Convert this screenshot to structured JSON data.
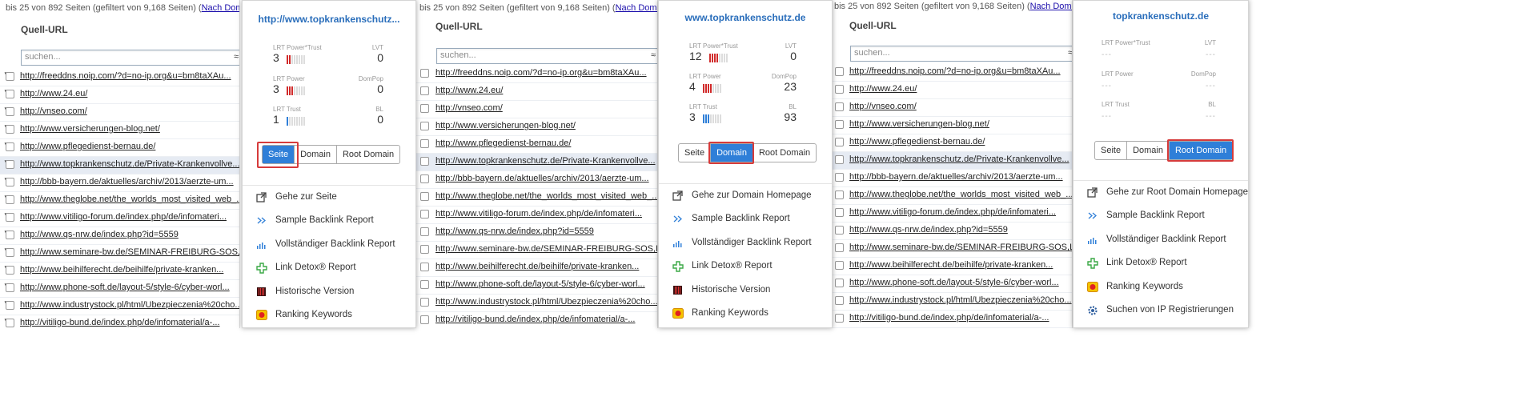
{
  "panel1": {
    "topinfo": "bis 25 von 892 Seiten (gefiltert von 9,168 Seiten) (",
    "toplink": "Nach Domain gr",
    "column": "Quell-URL",
    "search_placeholder": "suchen...",
    "search_symbol": "≈",
    "rows": [
      "http://freeddns.noip.com/?d=no-ip.org&u=bm8taXAu...",
      "http://www.24.eu/",
      "http://vnseo.com/",
      "http://www.versicherungen-blog.net/",
      "http://www.pflegedienst-bernau.de/",
      "http://www.topkrankenschutz.de/Private-Krankenvollve...",
      "http://bbb-bayern.de/aktuelles/archiv/2013/aerzte-um...",
      "http://www.theglobe.net/the_worlds_most_visited_web_...",
      "http://www.vitiligo-forum.de/index.php/de/infomateri...",
      "http://www.qs-nrw.de/index.php?id=5559",
      "http://www.seminare-bw.de/SEMINAR-FREIBURG-SOS,Lde/S...",
      "http://www.beihilferecht.de/beihilfe/private-kranken...",
      "http://www.phone-soft.de/layout-5/style-6/cyber-worl...",
      "http://www.industrystock.pl/html/Ubezpieczenia%20cho...",
      "http://vitiligo-bund.de/index.php/de/infomaterial/a-..."
    ]
  },
  "panel2": {
    "topinfo": "bis 25 von 892 Seiten (gefiltert von 9,168 Seiten) (",
    "toplink": "Nach Domain gr",
    "column": "Quell-URL",
    "search_placeholder": "suchen...",
    "search_symbol": "≈",
    "rows": [
      "http://freeddns.noip.com/?d=no-ip.org&u=bm8taXAu...",
      "http://www.24.eu/",
      "http://vnseo.com/",
      "http://www.versicherungen-blog.net/",
      "http://www.pflegedienst-bernau.de/",
      "http://www.topkrankenschutz.de/Private-Krankenvollve...",
      "http://bbb-bayern.de/aktuelles/archiv/2013/aerzte-um...",
      "http://www.theglobe.net/the_worlds_most_visited_web_...",
      "http://www.vitiligo-forum.de/index.php/de/infomateri...",
      "http://www.qs-nrw.de/index.php?id=5559",
      "http://www.seminare-bw.de/SEMINAR-FREIBURG-SOS,Lde/S...",
      "http://www.beihilferecht.de/beihilfe/private-kranken...",
      "http://www.phone-soft.de/layout-5/style-6/cyber-worl...",
      "http://www.industrystock.pl/html/Ubezpieczenia%20cho...",
      "http://vitiligo-bund.de/index.php/de/infomaterial/a-..."
    ]
  },
  "panel3": {
    "topinfo": "bis 25 von 892 Seiten (gefiltert von 9,168 Seiten) (",
    "toplink": "Nach Domain gr",
    "column": "Quell-URL",
    "search_placeholder": "suchen...",
    "search_symbol": "≈",
    "rows": [
      "http://freeddns.noip.com/?d=no-ip.org&u=bm8taXAu...",
      "http://www.24.eu/",
      "http://vnseo.com/",
      "http://www.versicherungen-blog.net/",
      "http://www.pflegedienst-bernau.de/",
      "http://www.topkrankenschutz.de/Private-Krankenvollve...",
      "http://bbb-bayern.de/aktuelles/archiv/2013/aerzte-um...",
      "http://www.theglobe.net/the_worlds_most_visited_web_...",
      "http://www.vitiligo-forum.de/index.php/de/infomateri...",
      "http://www.qs-nrw.de/index.php?id=5559",
      "http://www.seminare-bw.de/SEMINAR-FREIBURG-SOS,Lde/S...",
      "http://www.beihilferecht.de/beihilfe/private-kranken...",
      "http://www.phone-soft.de/layout-5/style-6/cyber-worl...",
      "http://www.industrystock.pl/html/Ubezpieczenia%20cho...",
      "http://vitiligo-bund.de/index.php/de/infomaterial/a-..."
    ]
  },
  "popup1": {
    "title": "http://www.topkrankenschutz...",
    "lrt_power_trust_label": "LRT Power*Trust",
    "lrt_power_trust_value": "3",
    "lvt_label": "LVT",
    "lvt_value": "0",
    "lrt_power_label": "LRT Power",
    "lrt_power_value": "3",
    "dompop_label": "DomPop",
    "dompop_value": "0",
    "lrt_trust_label": "LRT Trust",
    "lrt_trust_value": "1",
    "bl_label": "BL",
    "bl_value": "0",
    "btn_seite": "Seite",
    "btn_domain": "Domain",
    "btn_root": "Root Domain",
    "menu": [
      "Gehe zur Seite",
      "Sample Backlink Report",
      "Vollständiger Backlink Report",
      "Link Detox® Report",
      "Historische Version",
      "Ranking Keywords"
    ]
  },
  "popup2": {
    "title": "www.topkrankenschutz.de",
    "lrt_power_trust_label": "LRT Power*Trust",
    "lrt_power_trust_value": "12",
    "lvt_label": "LVT",
    "lvt_value": "0",
    "lrt_power_label": "LRT Power",
    "lrt_power_value": "4",
    "dompop_label": "DomPop",
    "dompop_value": "23",
    "lrt_trust_label": "LRT Trust",
    "lrt_trust_value": "3",
    "bl_label": "BL",
    "bl_value": "93",
    "btn_seite": "Seite",
    "btn_domain": "Domain",
    "btn_root": "Root Domain",
    "menu": [
      "Gehe zur Domain Homepage",
      "Sample Backlink Report",
      "Vollständiger Backlink Report",
      "Link Detox® Report",
      "Historische Version",
      "Ranking Keywords"
    ]
  },
  "popup3": {
    "title": "topkrankenschutz.de",
    "lrt_power_trust_label": "LRT Power*Trust",
    "lrt_power_trust_value": "---",
    "lvt_label": "LVT",
    "lvt_value": "---",
    "lrt_power_label": "LRT Power",
    "lrt_power_value": "---",
    "dompop_label": "DomPop",
    "dompop_value": "---",
    "lrt_trust_label": "LRT Trust",
    "lrt_trust_value": "---",
    "bl_label": "BL",
    "bl_value": "---",
    "btn_seite": "Seite",
    "btn_domain": "Domain",
    "btn_root": "Root Domain",
    "menu": [
      "Gehe zur Root Domain Homepage",
      "Sample Backlink Report",
      "Vollständiger Backlink Report",
      "Link Detox® Report",
      "Ranking Keywords",
      "Suchen von IP Registrierungen"
    ]
  },
  "colors": {
    "accent_blue": "#2f7fd8",
    "highlight_red": "#d63b3b",
    "link_blue": "#2a6ebb"
  }
}
